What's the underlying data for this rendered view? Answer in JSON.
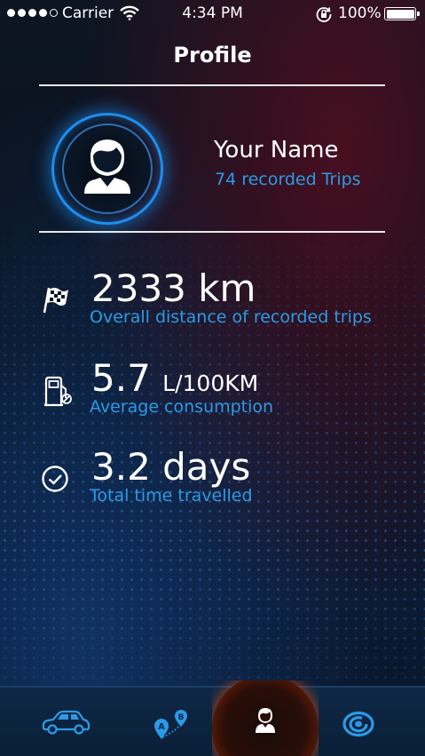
{
  "status_bar": {
    "carrier": "Carrier",
    "time": "4:34 PM",
    "battery_percent": "100%",
    "signal_bars_filled": 4,
    "signal_bars_total": 5
  },
  "header": {
    "title": "Profile"
  },
  "profile": {
    "name": "Your Name",
    "trips": "74 recorded Trips"
  },
  "stats": [
    {
      "icon": "checkered-flag-icon",
      "value": "2333 km",
      "unit": "",
      "label": "Overall distance of recorded trips"
    },
    {
      "icon": "fuel-pump-icon",
      "value": "5.7",
      "unit": "L/100KM",
      "label": "Average consumption"
    },
    {
      "icon": "clock-icon",
      "value": "3.2 days",
      "unit": "",
      "label": "Total time travelled"
    }
  ],
  "tabbar": {
    "tabs": [
      {
        "icon": "car-icon",
        "active": false
      },
      {
        "icon": "route-ab-icon",
        "active": false,
        "point_a": "A",
        "point_b": "B"
      },
      {
        "icon": "profile-icon",
        "active": true
      },
      {
        "icon": "logo-icon",
        "active": false
      }
    ]
  },
  "colors": {
    "accent_blue": "#2b9be6",
    "ring_blue": "#1e8ef0",
    "active_orange": "#ff6a10",
    "tabbar": "#0e2846"
  }
}
